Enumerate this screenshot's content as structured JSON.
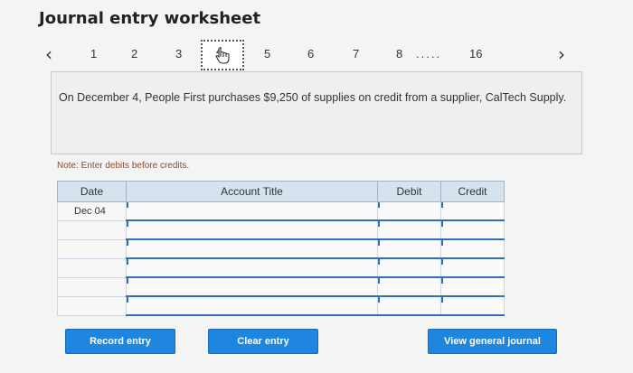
{
  "page_title": "Journal entry worksheet",
  "pager": {
    "prev_icon": "chevron-left-icon",
    "next_icon": "chevron-right-icon",
    "pages": [
      "1",
      "2",
      "3",
      "4",
      "5",
      "6",
      "7",
      "8"
    ],
    "active_page": "4",
    "ellipsis": ".....",
    "last_page": "16"
  },
  "prompt_text": "On December 4, People First purchases $9,250 of supplies on credit from a supplier, CalTech Supply.",
  "note": "Note: Enter debits before credits.",
  "table": {
    "headers": [
      "Date",
      "Account Title",
      "Debit",
      "Credit"
    ],
    "rows": [
      {
        "date": "Dec 04",
        "account": "",
        "debit": "",
        "credit": ""
      },
      {
        "date": "",
        "account": "",
        "debit": "",
        "credit": ""
      },
      {
        "date": "",
        "account": "",
        "debit": "",
        "credit": ""
      },
      {
        "date": "",
        "account": "",
        "debit": "",
        "credit": ""
      },
      {
        "date": "",
        "account": "",
        "debit": "",
        "credit": ""
      },
      {
        "date": "",
        "account": "",
        "debit": "",
        "credit": ""
      }
    ]
  },
  "buttons": {
    "record": "Record entry",
    "clear": "Clear entry",
    "view": "View general journal"
  },
  "colors": {
    "accent": "#1f86e0",
    "header_bg": "#d6e2ee",
    "note": "#8a4b2a"
  }
}
